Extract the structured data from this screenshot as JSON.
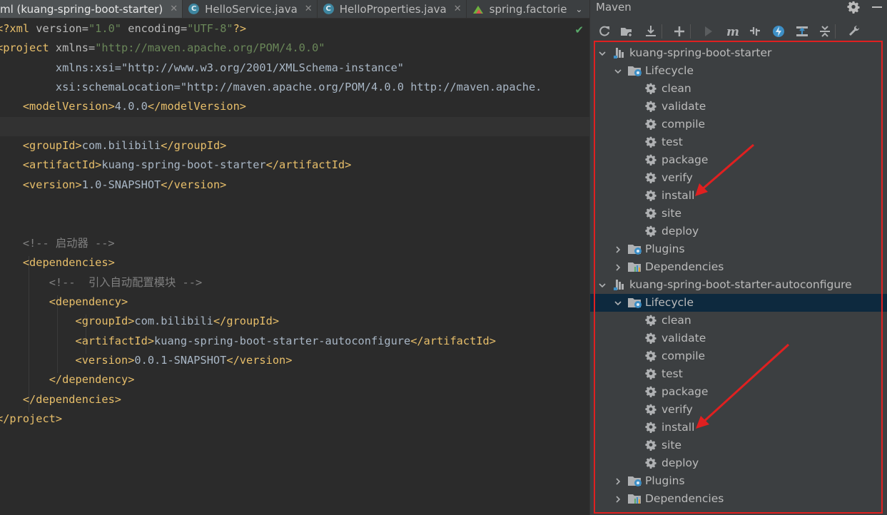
{
  "editor": {
    "tabs": [
      {
        "label": "ml (kuang-spring-boot-starter)",
        "icon": "",
        "close": "✕"
      },
      {
        "label": "HelloService.java",
        "icon": "class-icon",
        "close": "✕"
      },
      {
        "label": "HelloProperties.java",
        "icon": "class-icon",
        "close": "✕"
      },
      {
        "label": "spring.factorie",
        "icon": "spring-icon",
        "close": ""
      }
    ],
    "status_check": "✔",
    "lines": [
      "<?xml version=\"1.0\" encoding=\"UTF-8\"?>",
      "<project xmlns=\"http://maven.apache.org/POM/4.0.0\"",
      "         xmlns:xsi=\"http://www.w3.org/2001/XMLSchema-instance\"",
      "         xsi:schemaLocation=\"http://maven.apache.org/POM/4.0.0 http://maven.apache.",
      "    <modelVersion>4.0.0</modelVersion>",
      "",
      "    <groupId>com.bilibili</groupId>",
      "    <artifactId>kuang-spring-boot-starter</artifactId>",
      "    <version>1.0-SNAPSHOT</version>",
      "",
      "",
      "    <!-- 启动器 -->",
      "    <dependencies>",
      "        <!--  引入自动配置模块 -->",
      "        <dependency>",
      "            <groupId>com.bilibili</groupId>",
      "            <artifactId>kuang-spring-boot-starter-autoconfigure</artifactId>",
      "            <version>0.0.1-SNAPSHOT</version>",
      "        </dependency>",
      "    </dependencies>",
      "</project>"
    ]
  },
  "maven": {
    "title": "Maven",
    "toolbar": [
      "reload-icon",
      "add-folder-icon",
      "download-icon",
      "add-icon",
      "run-icon",
      "execute-goal-icon",
      "toggle-offline-icon",
      "skip-tests-icon",
      "show-dependencies-icon",
      "collapse-all-icon",
      "settings-wrench-icon"
    ],
    "projects": [
      {
        "name": "kuang-spring-boot-starter",
        "lifecycle_label": "Lifecycle",
        "lifecycle_selected": false,
        "phases": [
          "clean",
          "validate",
          "compile",
          "test",
          "package",
          "verify",
          "install",
          "site",
          "deploy"
        ],
        "plugins_label": "Plugins",
        "dependencies_label": "Dependencies"
      },
      {
        "name": "kuang-spring-boot-starter-autoconfigure",
        "lifecycle_label": "Lifecycle",
        "lifecycle_selected": true,
        "phases": [
          "clean",
          "validate",
          "compile",
          "test",
          "package",
          "verify",
          "install",
          "site",
          "deploy"
        ],
        "plugins_label": "Plugins",
        "dependencies_label": "Dependencies"
      }
    ]
  },
  "annotation_color": "#e02020"
}
